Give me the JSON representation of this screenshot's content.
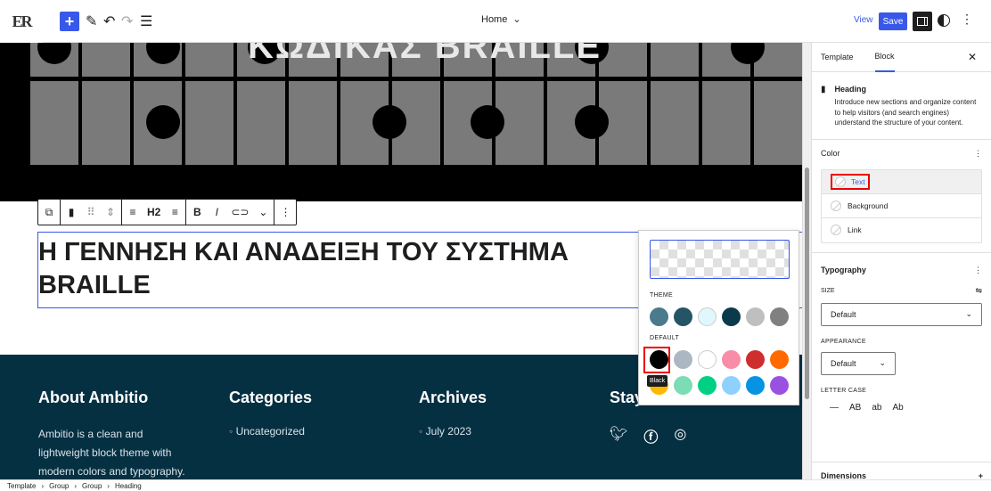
{
  "topbar": {
    "logo_text": "ER",
    "page_title": "Home",
    "view_label": "View",
    "save_label": "Save"
  },
  "canvas": {
    "braille_title": "ΚΩΔΙΚΑΣ BRAILLE",
    "heading_line1": "Η ΓΕΝΝΗΣΗ ΚΑΙ ΑΝΑΔΕΙΞΗ ΤΟΥ ΣΥΣΤΗΜΑ",
    "heading_line2": "BRAILLE",
    "toolbar_level": "H2"
  },
  "footer": {
    "col1_title": "About Ambitio",
    "col1_text_l1": "Ambitio is a clean and",
    "col1_text_l2": "lightweight block theme with",
    "col1_text_l3": "modern colors and typography.",
    "col2_title": "Categories",
    "col2_item": "Uncategorized",
    "col3_title": "Archives",
    "col3_item": "July 2023",
    "col4_title": "Stay in touch"
  },
  "popover": {
    "theme_label": "THEME",
    "default_label": "DEFAULT",
    "tooltip": "Black",
    "theme_colors": [
      "#4a7a8c",
      "#255466",
      "#e0f7fc",
      "#0c3a4d",
      "#bfbfbf",
      "#808080"
    ],
    "default_colors_row1": [
      "#000000",
      "#abb8c3",
      "#ffffff",
      "#f78da7",
      "#cf2e2e",
      "#ff6900"
    ],
    "default_colors_row2": [
      "#fcb900",
      "#7bdcb5",
      "#00d084",
      "#8ed1fc",
      "#0693e3",
      "#9b51e0"
    ]
  },
  "sidebar": {
    "tab_template": "Template",
    "tab_block": "Block",
    "block_name": "Heading",
    "block_desc": "Introduce new sections and organize content to help visitors (and search engines) understand the structure of your content.",
    "color_title": "Color",
    "color_text": "Text",
    "color_background": "Background",
    "color_link": "Link",
    "typography_title": "Typography",
    "size_label": "SIZE",
    "size_value": "Default",
    "appearance_label": "APPEARANCE",
    "appearance_value": "Default",
    "letter_case_label": "LETTER CASE",
    "case_none": "—",
    "case_upper": "AB",
    "case_lower": "ab",
    "case_capital": "Ab",
    "dimensions_title": "Dimensions"
  },
  "breadcrumbs": [
    "Template",
    "Group",
    "Group",
    "Heading"
  ]
}
